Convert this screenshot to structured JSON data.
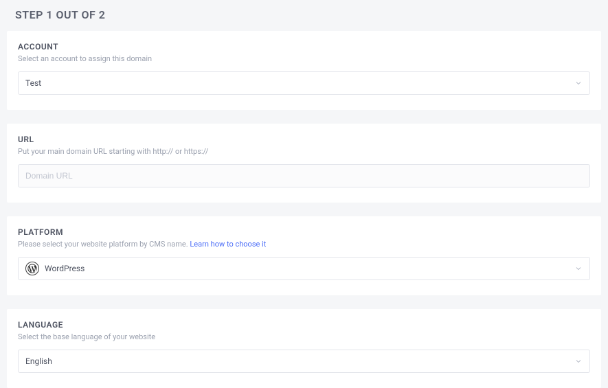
{
  "page": {
    "title": "STEP 1 OUT OF 2"
  },
  "account": {
    "title": "ACCOUNT",
    "desc": "Select an account to assign this domain",
    "selected": "Test"
  },
  "url": {
    "title": "URL",
    "desc": "Put your main domain URL starting with http:// or https://",
    "placeholder": "Domain URL",
    "value": ""
  },
  "platform": {
    "title": "PLATFORM",
    "desc_prefix": "Please select your website platform by CMS name. ",
    "learn_link": "Learn how to choose it",
    "selected": "WordPress",
    "icon": "wordpress"
  },
  "language": {
    "title": "LANGUAGE",
    "desc": "Select the base language of your website",
    "selected": "English"
  }
}
